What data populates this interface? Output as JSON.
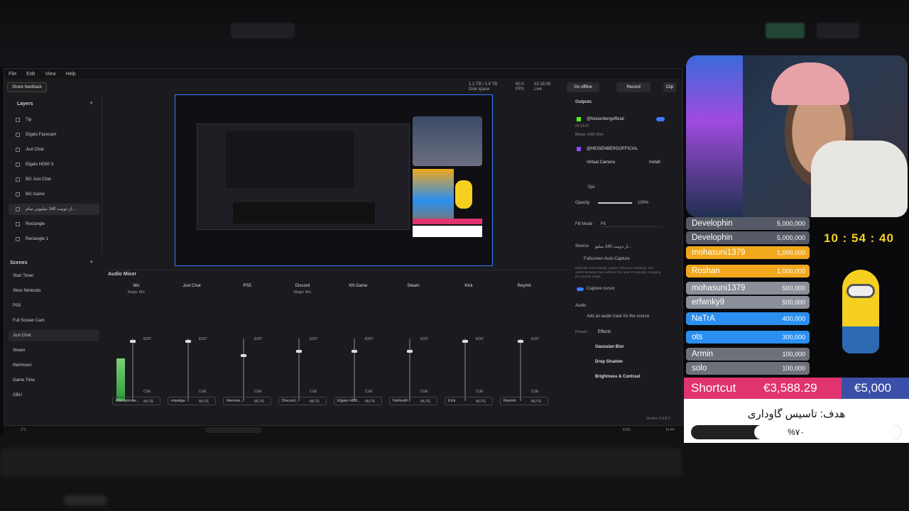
{
  "app": {
    "menu": [
      "File",
      "Edit",
      "View",
      "Help"
    ],
    "share_feedback": "Share feedback",
    "disk": "1.2 TB / 1.8 TB",
    "disk_label": "Disk space",
    "fps": "60.0",
    "fps_label": "FPS",
    "time": "02:15:09",
    "live": "Live",
    "go_offline": "Go offline",
    "record": "Record",
    "clip": "Clip"
  },
  "layers": {
    "title": "Layers",
    "items": [
      "Tip",
      "Elgato Facecam",
      "Just Chat",
      "Elgato HD60 X",
      "BG Just Chat",
      "BG Game",
      "از دونیت 140 میلیونی سام...",
      "Rectangle",
      "Rectangle 1"
    ],
    "selected": 6
  },
  "scenes": {
    "title": "Scenes",
    "items": [
      "Start Timer",
      "Xbox Nintendo",
      "PS5",
      "Full Screen Cam",
      "Just Chat",
      "Steam",
      "Mehmoon",
      "Game Time",
      "GBU"
    ],
    "selected": 4
  },
  "mixer": {
    "title": "Audio Mixer",
    "channels": [
      {
        "name": "Mic",
        "sub": "Magic Mic",
        "src": "Microphone..."
      },
      {
        "name": "Just Chat",
        "sub": "",
        "src": "msedge..."
      },
      {
        "name": "PS5",
        "sub": "",
        "src": "Remme..."
      },
      {
        "name": "Discord",
        "sub": "Magic Mic",
        "src": "Discord..."
      },
      {
        "name": "XN Game",
        "sub": "",
        "src": "Elgato HD6..."
      },
      {
        "name": "Steam",
        "sub": "",
        "src": "NoRestF..."
      },
      {
        "name": "Kick",
        "sub": "",
        "src": "Kick"
      },
      {
        "name": "Reymit",
        "sub": "",
        "src": "Reymit"
      }
    ],
    "edit": "EDIT",
    "cue": "CUE",
    "mute": "MUTE"
  },
  "props": {
    "outputs": "Outputs",
    "acc1": "@heisenbergofficial",
    "acc1_time": "02:15:07",
    "acc1_bitrate": "Bitrate: 8492 Kb/s",
    "acc2": "@HEISENBERGOFFICIAL",
    "virtual_camera": "Virtual Camera",
    "install": "Install",
    "radius": "0px",
    "opacity": "Opacity",
    "opacity_val": "100%",
    "fill_mode": "Fill Mode",
    "fit": "Fit",
    "source": "Source",
    "source_val": "از دونیت 140 میلیو...",
    "auto_capture": "Fullscreen Auto-Capture",
    "auto_desc": "Meld will automatically capture fullscreen windows, and switch between them without the need of manually changing the capture target.",
    "capture_cursor": "Capture cursor",
    "audio": "Audio",
    "add_audio": "Add an audio track for the source",
    "presets": "Presets",
    "effects": "Effects",
    "effect_items": [
      "Gaussian Blur",
      "Drop Shadow",
      "Brightness & Contrast"
    ],
    "version": "Version 0.9.8.3"
  },
  "overlay": {
    "clock": "10 : 54 : 40",
    "leaderboard": [
      {
        "name": "Develophin",
        "amount": "5,000,000",
        "color": "#555a66"
      },
      {
        "name": "Develophin",
        "amount": "5,000,000",
        "color": "#555a66"
      },
      {
        "name": "mohasuni1379",
        "amount": "1,000,000",
        "color": "#f2a81d"
      },
      {
        "name": "Roshan",
        "amount": "1,000,000",
        "color": "#f2a81d"
      },
      {
        "name": "mohasuni1379",
        "amount": "500,000",
        "color": "#8a8f99"
      },
      {
        "name": "erfwnky9",
        "amount": "500,000",
        "color": "#8a8f99"
      },
      {
        "name": "NaTrA",
        "amount": "400,000",
        "color": "#2a8ff0"
      },
      {
        "name": "ots",
        "amount": "300,000",
        "color": "#2a8ff0"
      },
      {
        "name": "Armin",
        "amount": "100,000",
        "color": "#6e717a"
      },
      {
        "name": "solo",
        "amount": "100,000",
        "color": "#6e717a"
      }
    ],
    "shortcut": "Shortcut",
    "current": "€3,588.29",
    "target": "€5,000",
    "goal_title": "هدف: تاسیس گاوداری",
    "goal_percent": "%۷۰",
    "goal_fraction": 0.7
  },
  "taskbar": {
    "weather": "2°C",
    "lang": "ENG",
    "time": "14:44"
  }
}
